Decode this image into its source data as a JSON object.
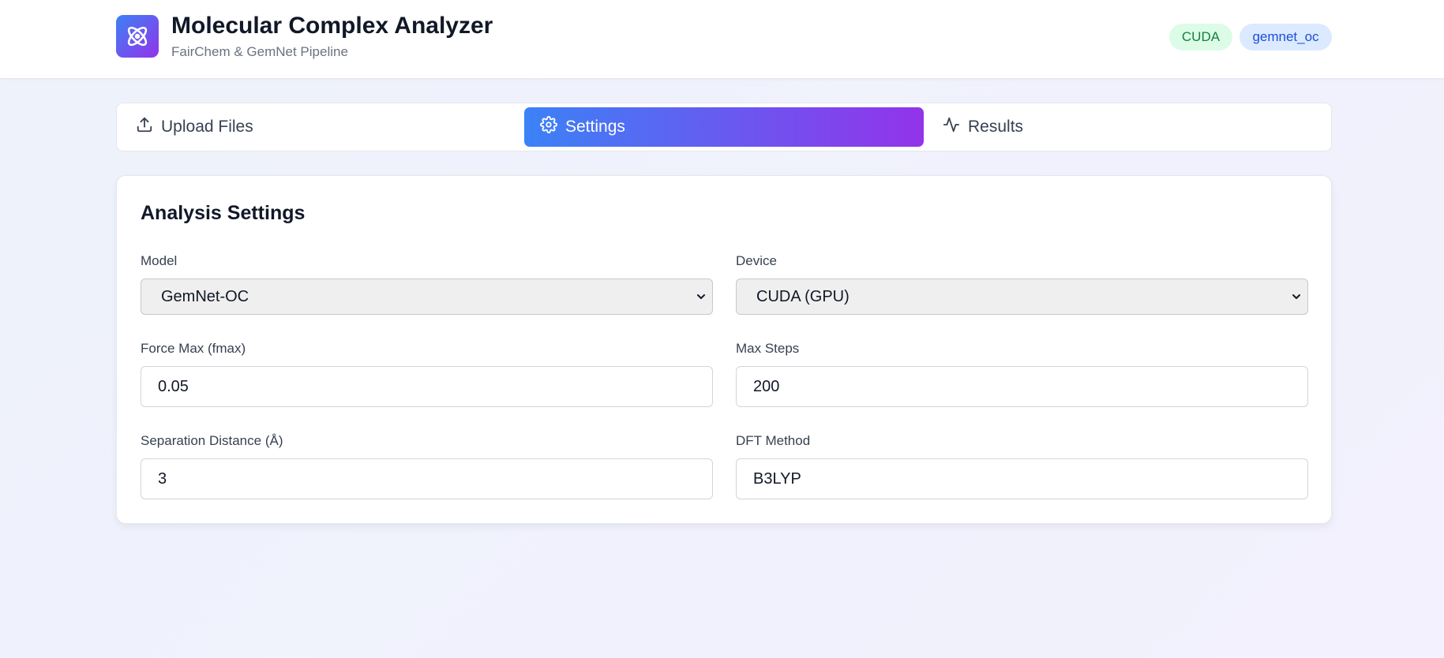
{
  "header": {
    "logo_icon": "atom-icon",
    "title": "Molecular Complex Analyzer",
    "subtitle": "FairChem & GemNet Pipeline",
    "badges": [
      {
        "label": "CUDA",
        "color": "#15803d",
        "bg": "#dcfce7"
      },
      {
        "label": "gemnet_oc",
        "color": "#1d4ed8",
        "bg": "#dbeafe"
      }
    ]
  },
  "tabs": [
    {
      "label": "Upload Files",
      "icon": "upload-icon",
      "active": false
    },
    {
      "label": "Settings",
      "icon": "gear-icon",
      "active": true
    },
    {
      "label": "Results",
      "icon": "activity-icon",
      "active": false
    }
  ],
  "settings": {
    "title": "Analysis Settings",
    "model": {
      "label": "Model",
      "value": "GemNet-OC"
    },
    "device": {
      "label": "Device",
      "value": "CUDA (GPU)"
    },
    "fmax": {
      "label": "Force Max (fmax)",
      "value": "0.05"
    },
    "max_steps": {
      "label": "Max Steps",
      "value": "200"
    },
    "separation": {
      "label": "Separation Distance (Å)",
      "value": "3"
    },
    "dft_method": {
      "label": "DFT Method",
      "value": "B3LYP"
    }
  },
  "colors": {
    "accent_start": "#3b82f6",
    "accent_end": "#9333ea"
  }
}
